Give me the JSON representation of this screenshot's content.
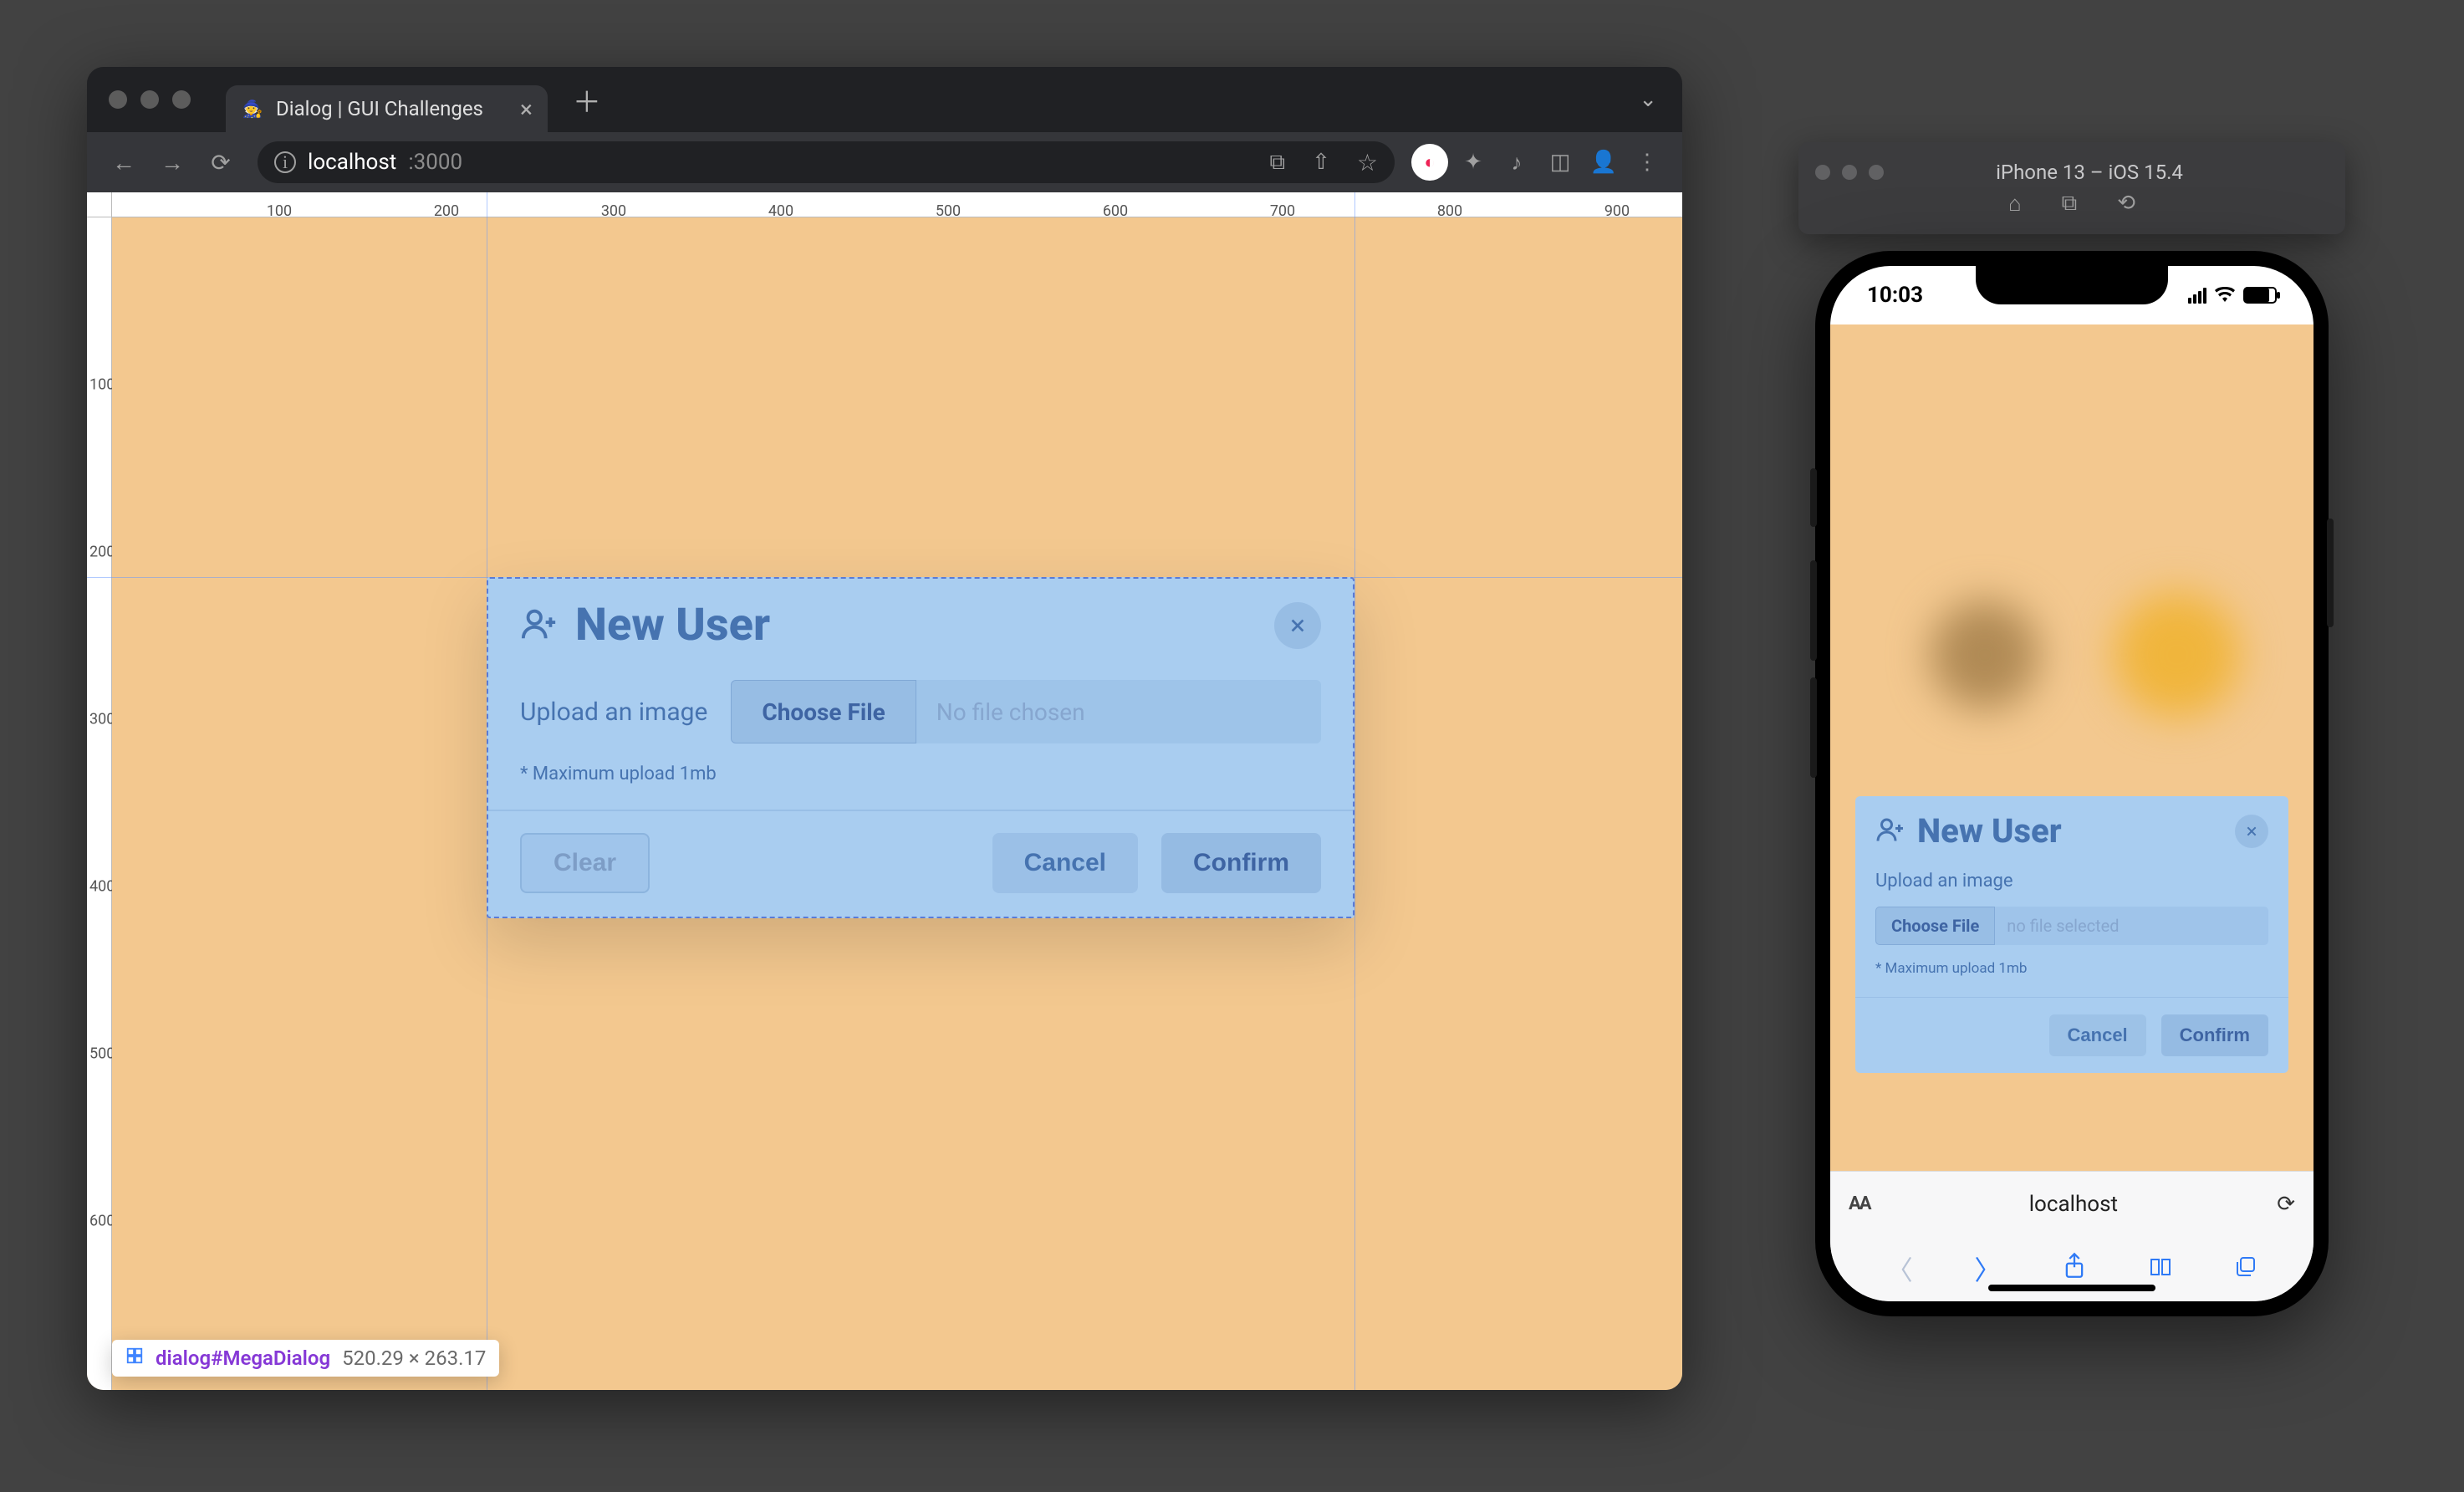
{
  "browser": {
    "tab_title": "Dialog | GUI Challenges",
    "url_host": "localhost",
    "url_port": ":3000"
  },
  "ruler": {
    "h": [
      "100",
      "200",
      "300",
      "400",
      "500",
      "600",
      "700",
      "800",
      "900"
    ],
    "v": [
      "100",
      "200",
      "300",
      "400",
      "500",
      "600"
    ]
  },
  "dialog": {
    "title": "New User",
    "upload_label": "Upload an image",
    "choose_file": "Choose File",
    "no_file": "No file chosen",
    "hint": "* Maximum upload 1mb",
    "clear": "Clear",
    "cancel": "Cancel",
    "confirm": "Confirm"
  },
  "inspect": {
    "selector": "dialog#MegaDialog",
    "dimensions": "520.29 × 263.17"
  },
  "simulator": {
    "title": "iPhone 13 – iOS 15.4"
  },
  "phone": {
    "time": "10:03",
    "dialog": {
      "title": "New User",
      "upload_label": "Upload an image",
      "choose_file": "Choose File",
      "no_file": "no file selected",
      "hint": "* Maximum upload 1mb",
      "cancel": "Cancel",
      "confirm": "Confirm"
    },
    "address": "localhost"
  }
}
